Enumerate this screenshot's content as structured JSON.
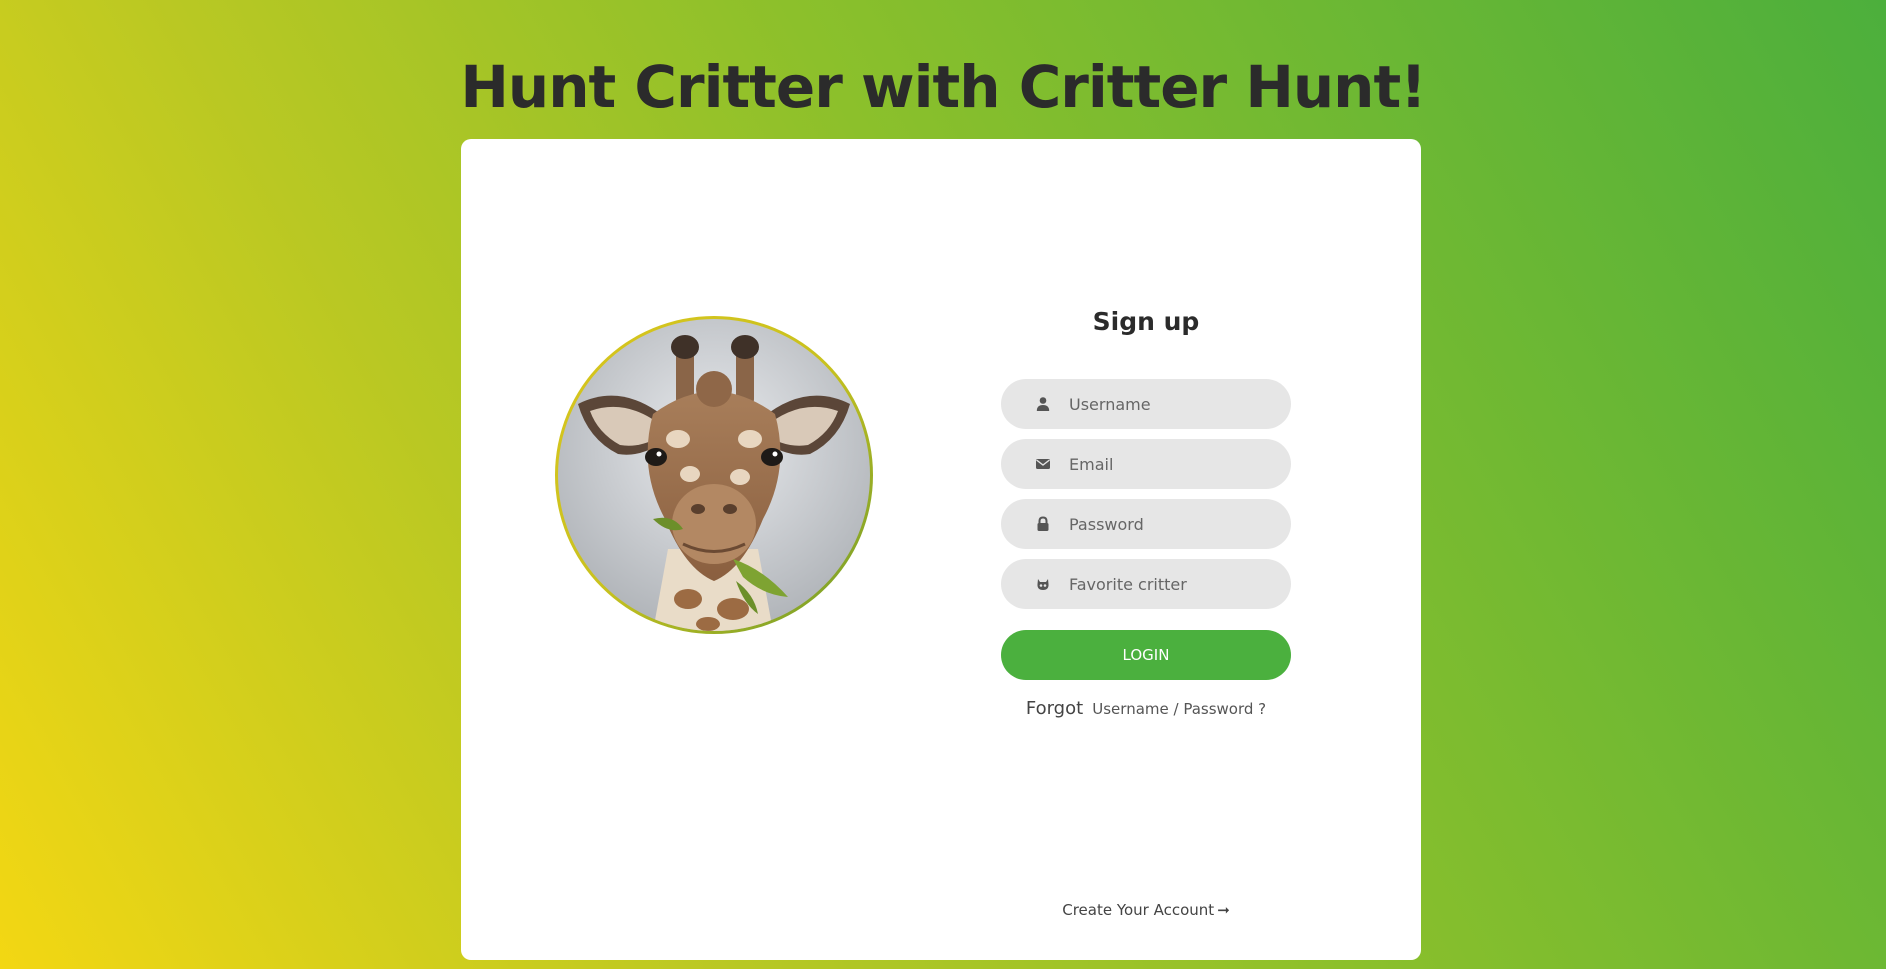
{
  "header": {
    "title": "Hunt Critter with Critter Hunt!"
  },
  "avatar": {
    "alt": "giraffe-photo"
  },
  "signup": {
    "title": "Sign up",
    "fields": [
      {
        "icon": "user-icon",
        "placeholder": "Username"
      },
      {
        "icon": "envelope-icon",
        "placeholder": "Email"
      },
      {
        "icon": "lock-icon",
        "placeholder": "Password"
      },
      {
        "icon": "critter-icon",
        "placeholder": "Favorite critter"
      }
    ],
    "submit_label": "LOGIN",
    "forgot_prefix": "Forgot",
    "forgot_link": "Username / Password ?",
    "create_account": "Create Your Account"
  },
  "colors": {
    "accent": "#4bb03e",
    "field_bg": "#e6e6e6",
    "gradient_start": "#f3d713",
    "gradient_end": "#4caf3c"
  }
}
